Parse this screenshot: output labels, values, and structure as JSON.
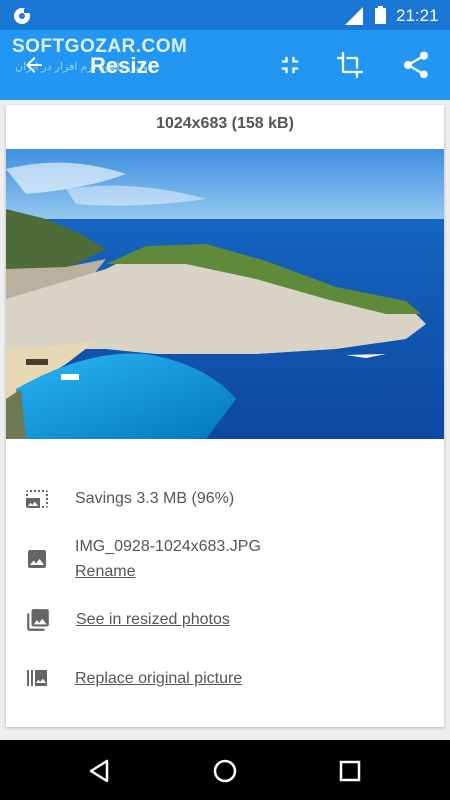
{
  "status_bar": {
    "time": "21:21",
    "icons": [
      "notification-icon",
      "signal-icon",
      "battery-icon"
    ]
  },
  "app_bar": {
    "title": "Resize",
    "watermark": "SOFTGOZAR.COM",
    "watermark_sub": "اولین دانلود نرم افزار در ایران",
    "actions": [
      "back-arrow-icon",
      "compress-icon",
      "crop-icon",
      "share-icon"
    ],
    "color": "#2196f3",
    "status_color": "#1976d2"
  },
  "card": {
    "dimensions": "1024x683 (158 kB)",
    "savings": "Savings 3.3 MB (96%)",
    "file_name": "IMG_0928-1024x683.JPG",
    "rename_label": "Rename",
    "see_resized_label": "See in resized photos",
    "replace_label": "Replace original picture"
  },
  "nav_bar": {
    "buttons": [
      "back-triangle-icon",
      "home-circle-icon",
      "recents-square-icon"
    ]
  }
}
